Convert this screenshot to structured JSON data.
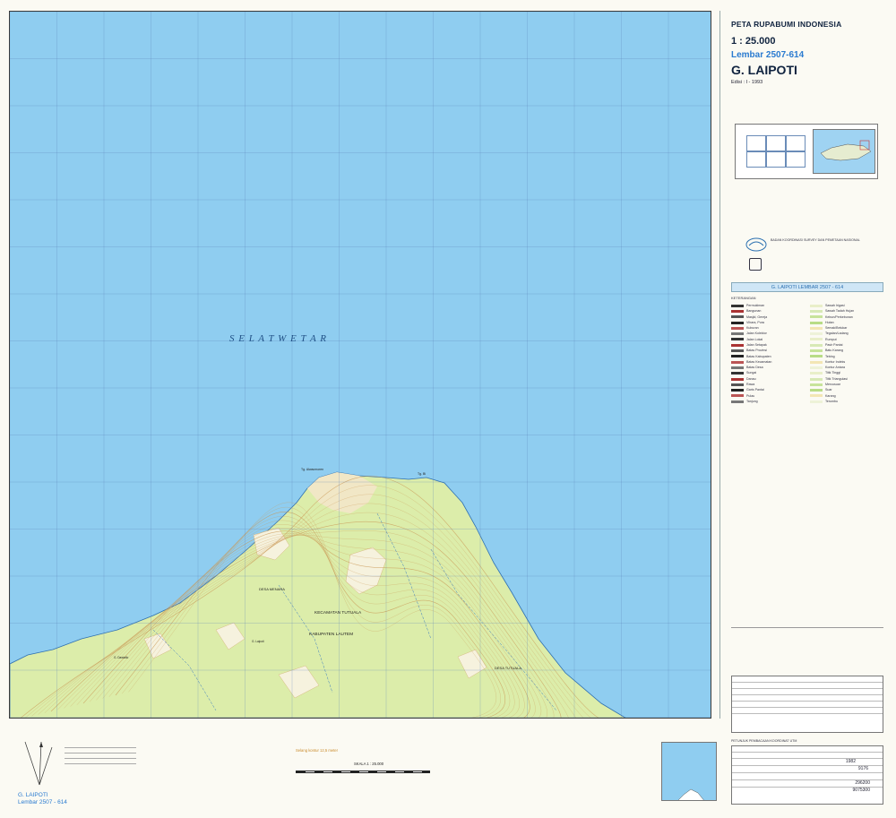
{
  "header": {
    "series_title": "PETA RUPABUMI INDONESIA",
    "scale": "1 : 25.000",
    "sheet_number": "Lembar 2507-614",
    "sheet_name": "G. LAIPOTI",
    "edition": "Edisi : I - 1993"
  },
  "map": {
    "sea_label": "S E L A T   W E T A R",
    "place_labels": {
      "cape_west": "Tg. Alwacmoren",
      "cape_east": "Tg. Bi",
      "desa_menara": "DESA MENARA",
      "kecamatan": "KECAMATAN TUTUALA",
      "kabupaten": "KABUPATEN LAUTEM",
      "desa_tutuala": "DESA TUTUALA",
      "peak": "G. Laipoti",
      "peak2": "G. Dawiallo"
    },
    "colors": {
      "sea": "#8fcdf0",
      "land": "#dcedaa",
      "contour": "#c99855",
      "grid": "#5a7fb8",
      "coast": "#2e6fb0"
    }
  },
  "panel": {
    "bluebar": "G. LAIPOTI   LEMBAR   2507 - 614",
    "legend_title": "KETERANGAN",
    "legend_left": [
      "Permukiman",
      "Bangunan",
      "Masjid, Gereja",
      "Vihara, Pura",
      "Kuburan",
      "Jalan Kolektor",
      "Jalan Lokal",
      "Jalan Setapak",
      "Batas Provinsi",
      "Batas Kabupaten",
      "Batas Kecamatan",
      "Batas Desa",
      "Sungai",
      "Danau",
      "Rawa",
      "Garis Pantai",
      "Pulau",
      "Tanjung"
    ],
    "legend_right": [
      "Sawah Irigasi",
      "Sawah Tadah Hujan",
      "Kebun/Perkebunan",
      "Hutan",
      "Semak/Belukar",
      "Tegalan/Ladang",
      "Rumput",
      "Pasir Pantai",
      "Batu Karang",
      "Tebing",
      "Kontur Indeks",
      "Kontur Antara",
      "Titik Tinggi",
      "Titik Triangulasi",
      "Mercusuar",
      "Suar",
      "Karang",
      "Terumbu"
    ],
    "ppm_title": "BADAN KOORDINASI SURVEY DAN PEMETAAN NASIONAL",
    "grid_title": "PETUNJUK PEMBACAAN KOORDINAT UTM",
    "grid_values": [
      "1982",
      "9176",
      "296200",
      "9075300"
    ]
  },
  "footer": {
    "sheet_name": "G. LAIPOTI",
    "sheet_number": "Lembar 2507 - 614",
    "scale_text": "SKALA  1 : 25.000",
    "contour_note": "Selang kontur 12,5 meter"
  }
}
